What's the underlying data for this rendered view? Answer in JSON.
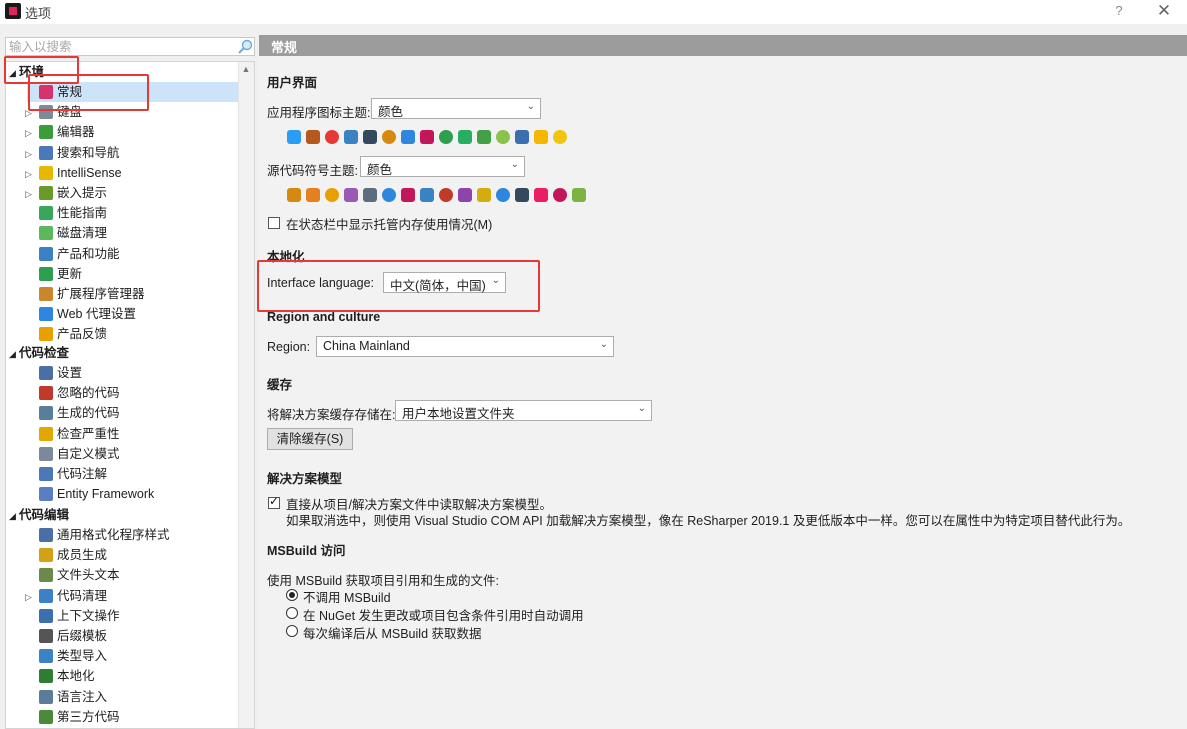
{
  "window": {
    "title": "选项",
    "help_label": "?",
    "close_label": "✕"
  },
  "search": {
    "placeholder": "输入以搜索"
  },
  "tree": {
    "environment": {
      "label": "环境",
      "items": [
        {
          "label": "常规",
          "icon": "resharper-icon",
          "color": "#d6336c"
        },
        {
          "label": "键盘",
          "icon": "keyboard-icon",
          "color": "#7d8b99"
        },
        {
          "label": "编辑器",
          "icon": "pencil-icon",
          "color": "#3a9c3a"
        },
        {
          "label": "搜索和导航",
          "icon": "search-nav-icon",
          "color": "#4a78b8"
        },
        {
          "label": "IntelliSense",
          "icon": "lightbulb-icon",
          "color": "#e6b800"
        },
        {
          "label": "嵌入提示",
          "icon": "inlay-hints-icon",
          "color": "#6a9a2a"
        },
        {
          "label": "性能指南",
          "icon": "performance-icon",
          "color": "#3aa65c"
        },
        {
          "label": "磁盘清理",
          "icon": "disk-cleanup-icon",
          "color": "#5cb85c"
        },
        {
          "label": "产品和功能",
          "icon": "products-icon",
          "color": "#3b82c4"
        },
        {
          "label": "更新",
          "icon": "update-icon",
          "color": "#2e9e4f"
        },
        {
          "label": "扩展程序管理器",
          "icon": "extension-manager-icon",
          "color": "#c9872a"
        },
        {
          "label": "Web 代理设置",
          "icon": "web-proxy-icon",
          "color": "#2e86de"
        },
        {
          "label": "产品反馈",
          "icon": "feedback-mail-icon",
          "color": "#e8a000"
        }
      ]
    },
    "code_inspection": {
      "label": "代码检查",
      "items": [
        {
          "label": "设置",
          "icon": "settings-person-icon",
          "color": "#4a6fa5"
        },
        {
          "label": "忽略的代码",
          "icon": "ignored-code-icon",
          "color": "#c0392b"
        },
        {
          "label": "生成的代码",
          "icon": "generated-code-icon",
          "color": "#5a7d9a"
        },
        {
          "label": "检查严重性",
          "icon": "severity-icon",
          "color": "#e0a800"
        },
        {
          "label": "自定义模式",
          "icon": "custom-pattern-icon",
          "color": "#7a8a9a"
        },
        {
          "label": "代码注解",
          "icon": "annotation-icon",
          "color": "#4a78b8"
        },
        {
          "label": "Entity Framework",
          "icon": "entity-framework-icon",
          "color": "#5a7fc0"
        }
      ]
    },
    "code_editing": {
      "label": "代码编辑",
      "items": [
        {
          "label": "通用格式化程序样式",
          "icon": "formatter-icon",
          "color": "#4a6fa5"
        },
        {
          "label": "成员生成",
          "icon": "member-generation-icon",
          "color": "#d4a017"
        },
        {
          "label": "文件头文本",
          "icon": "file-header-icon",
          "color": "#6a8a4a"
        },
        {
          "label": "代码清理",
          "icon": "code-cleanup-icon",
          "color": "#3b82c4"
        },
        {
          "label": "上下文操作",
          "icon": "context-action-icon",
          "color": "#3b6fb0"
        },
        {
          "label": "后缀模板",
          "icon": "postfix-template-icon",
          "color": "#555555"
        },
        {
          "label": "类型导入",
          "icon": "type-import-icon",
          "color": "#3b82c4"
        },
        {
          "label": "本地化",
          "icon": "localization-icon",
          "color": "#2e7d32"
        },
        {
          "label": "语言注入",
          "icon": "language-injection-icon",
          "color": "#5a7d9a"
        },
        {
          "label": "第三方代码",
          "icon": "third-party-code-icon",
          "color": "#4a8a3a"
        }
      ]
    }
  },
  "main": {
    "header": "常规",
    "ui_section": "用户界面",
    "icon_theme_label": "应用程序图标主题:",
    "icon_theme_value": "颜色",
    "symbol_theme_label": "源代码符号主题:",
    "symbol_theme_value": "颜色",
    "memory_checkbox_label": "在状态栏中显示托管内存使用情况(M)",
    "memory_checked": false,
    "localization_section": "本地化",
    "interface_language_label": "Interface language:",
    "interface_language_value": "中文(简体，中国)",
    "region_section": "Region and culture",
    "region_label": "Region:",
    "region_value": "China Mainland",
    "cache_section": "缓存",
    "cache_location_label": "将解决方案缓存存储在:",
    "cache_location_value": "用户本地设置文件夹",
    "clear_cache_button": "清除缓存(S)",
    "solution_model_section": "解决方案模型",
    "solution_model_checkbox": "直接从项目/解决方案文件中读取解决方案模型。",
    "solution_model_checked": true,
    "solution_model_desc": "如果取消选中，则使用 Visual Studio COM API 加载解决方案模型，像在 ReSharper 2019.1 及更低版本中一样。您可以在属性中为特定项目替代此行为。",
    "msbuild_section": "MSBuild 访问",
    "msbuild_desc": "使用 MSBuild 获取项目引用和生成的文件:",
    "msbuild_options": [
      {
        "label": "不调用 MSBuild",
        "selected": true
      },
      {
        "label": "在 NuGet 发生更改或项目包含条件引用时自动调用",
        "selected": false
      },
      {
        "label": "每次编译后从 MSBuild 获取数据",
        "selected": false
      }
    ]
  },
  "theme_icons": [
    {
      "name": "flask-icon",
      "color": "#2a9df4"
    },
    {
      "name": "hammer-icon",
      "color": "#b55a1f"
    },
    {
      "name": "no-entry-icon",
      "color": "#e53935"
    },
    {
      "name": "connector-icon",
      "color": "#3b82c4"
    },
    {
      "name": "calculator-icon",
      "color": "#34495e"
    },
    {
      "name": "clock-icon",
      "color": "#d68910"
    },
    {
      "name": "magnifier-icon",
      "color": "#2e86de"
    },
    {
      "name": "triangle-icon",
      "color": "#c2185b"
    },
    {
      "name": "recycle-icon",
      "color": "#2e9e4f"
    },
    {
      "name": "refresh-icon",
      "color": "#27ae60"
    },
    {
      "name": "checkmark-icon",
      "color": "#43a047"
    },
    {
      "name": "capsule-icon",
      "color": "#8bc34a"
    },
    {
      "name": "timer-icon",
      "color": "#3b6fb0"
    },
    {
      "name": "warning-icon",
      "color": "#f5b700"
    },
    {
      "name": "lightbulb-icon",
      "color": "#f1c40f"
    }
  ],
  "symbol_icons": [
    {
      "name": "box-icon",
      "color": "#d68910"
    },
    {
      "name": "class-icon",
      "color": "#e67e22"
    },
    {
      "name": "copy-icon",
      "color": "#e8a000"
    },
    {
      "name": "cubes-icon",
      "color": "#9b59b6"
    },
    {
      "name": "struct-icon",
      "color": "#5d6d7e"
    },
    {
      "name": "interface-icon",
      "color": "#2e86de"
    },
    {
      "name": "hexagon-icon",
      "color": "#c2185b"
    },
    {
      "name": "method-icon",
      "color": "#3b82c4"
    },
    {
      "name": "event-icon",
      "color": "#c0392b"
    },
    {
      "name": "delegate-icon",
      "color": "#8e44ad"
    },
    {
      "name": "property-icon",
      "color": "#d4ac0d"
    },
    {
      "name": "brackets-icon",
      "color": "#2e86de"
    },
    {
      "name": "field-icon",
      "color": "#34495e"
    },
    {
      "name": "enum-icon",
      "color": "#e91e63"
    },
    {
      "name": "indexer-icon",
      "color": "#c2185b"
    },
    {
      "name": "dot-icon",
      "color": "#7cb342"
    }
  ]
}
